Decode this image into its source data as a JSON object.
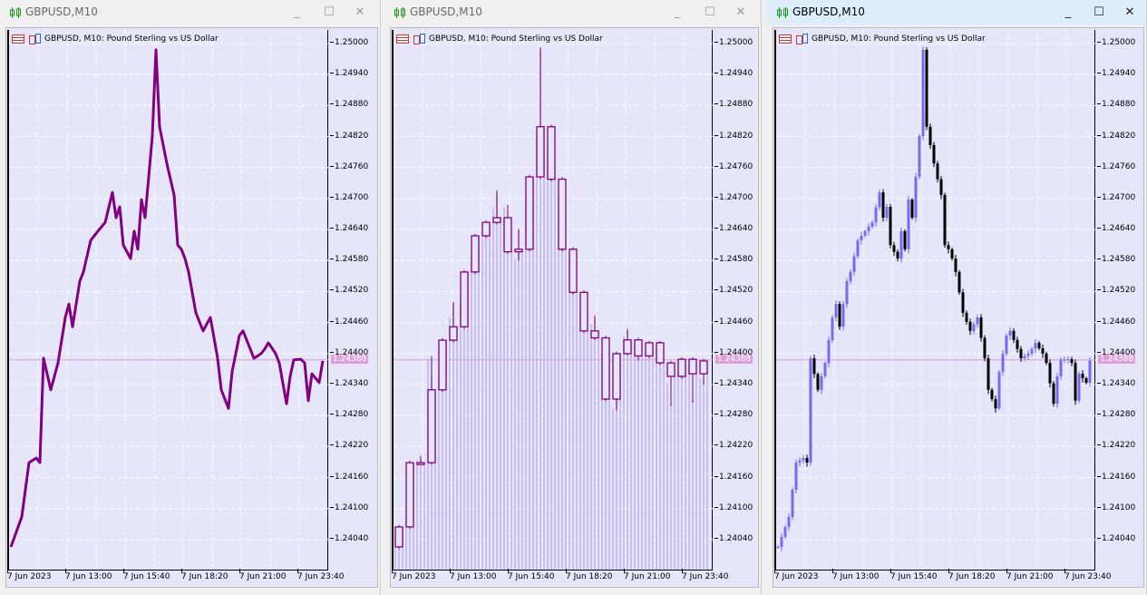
{
  "windows": [
    {
      "title": "GBPUSD,M10",
      "header": "GBPUSD, M10:  Pound Sterling vs US Dollar",
      "mode": "line",
      "active": false
    },
    {
      "title": "GBPUSD,M10",
      "header": "GBPUSD, M10:  Pound Sterling vs US Dollar",
      "mode": "bars",
      "active": false
    },
    {
      "title": "GBPUSD,M10",
      "header": "GBPUSD, M10:  Pound Sterling vs US Dollar",
      "mode": "candles",
      "active": true
    }
  ],
  "buttons": {
    "minimize": "_",
    "maximize": "☐",
    "close": "✕"
  },
  "colors": {
    "background": "#e6e6fa",
    "line": "#800080",
    "bull": "#7b68ee",
    "bear": "#000000",
    "volume_bar": "#c8c0f0",
    "current_price": "#dda0dd",
    "grid": "#ffffff"
  },
  "chart_data": {
    "type": "line",
    "symbol": "GBPUSD",
    "timeframe": "M10",
    "y_ticks": [
      "1.25000",
      "1.24940",
      "1.24880",
      "1.24820",
      "1.24760",
      "1.24700",
      "1.24640",
      "1.24580",
      "1.24520",
      "1.24460",
      "1.24400",
      "1.24340",
      "1.24280",
      "1.24220",
      "1.24160",
      "1.24100",
      "1.24040"
    ],
    "x_ticks": [
      "7 Jun 2023",
      "7 Jun 13:00",
      "7 Jun 15:40",
      "7 Jun 18:20",
      "7 Jun 21:00",
      "7 Jun 23:40"
    ],
    "current_price": "1.24388",
    "ylim": [
      1.24,
      1.2503
    ],
    "grid": true,
    "points": [
      [
        "10:20",
        1.24026
      ],
      [
        "10:50",
        1.24084
      ],
      [
        "11:10",
        1.24189
      ],
      [
        "11:30",
        1.24198
      ],
      [
        "11:40",
        1.24189
      ],
      [
        "11:50",
        1.24391
      ],
      [
        "12:10",
        1.2433
      ],
      [
        "12:30",
        1.24382
      ],
      [
        "12:50",
        1.2447
      ],
      [
        "13:00",
        1.24496
      ],
      [
        "13:10",
        1.24452
      ],
      [
        "13:30",
        1.2454
      ],
      [
        "13:40",
        1.24558
      ],
      [
        "14:00",
        1.24619
      ],
      [
        "14:20",
        1.24637
      ],
      [
        "14:40",
        1.24654
      ],
      [
        "15:00",
        1.24712
      ],
      [
        "15:10",
        1.24663
      ],
      [
        "15:20",
        1.24684
      ],
      [
        "15:30",
        1.2461
      ],
      [
        "15:50",
        1.24584
      ],
      [
        "16:00",
        1.24637
      ],
      [
        "16:10",
        1.24602
      ],
      [
        "16:20",
        1.24698
      ],
      [
        "16:30",
        1.24663
      ],
      [
        "16:50",
        1.24821
      ],
      [
        "17:00",
        1.24988
      ],
      [
        "17:10",
        1.24839
      ],
      [
        "17:30",
        1.24768
      ],
      [
        "17:50",
        1.24707
      ],
      [
        "18:00",
        1.2461
      ],
      [
        "18:10",
        1.24602
      ],
      [
        "18:20",
        1.24584
      ],
      [
        "18:30",
        1.24558
      ],
      [
        "18:50",
        1.24479
      ],
      [
        "19:10",
        1.24444
      ],
      [
        "19:30",
        1.2447
      ],
      [
        "19:50",
        1.24391
      ],
      [
        "20:00",
        1.2433
      ],
      [
        "20:20",
        1.24294
      ],
      [
        "20:30",
        1.24365
      ],
      [
        "20:50",
        1.24435
      ],
      [
        "21:00",
        1.24444
      ],
      [
        "21:20",
        1.24409
      ],
      [
        "21:30",
        1.24391
      ],
      [
        "21:50",
        1.244
      ],
      [
        "22:00",
        1.24409
      ],
      [
        "22:10",
        1.24421
      ],
      [
        "22:30",
        1.244
      ],
      [
        "22:40",
        1.24382
      ],
      [
        "23:00",
        1.24303
      ],
      [
        "23:10",
        1.24356
      ],
      [
        "23:20",
        1.24388
      ],
      [
        "23:40",
        1.24389
      ],
      [
        "23:50",
        1.24382
      ],
      [
        "00:00",
        1.24309
      ],
      [
        "00:10",
        1.24361
      ],
      [
        "00:30",
        1.24344
      ],
      [
        "00:40",
        1.24386
      ]
    ]
  }
}
